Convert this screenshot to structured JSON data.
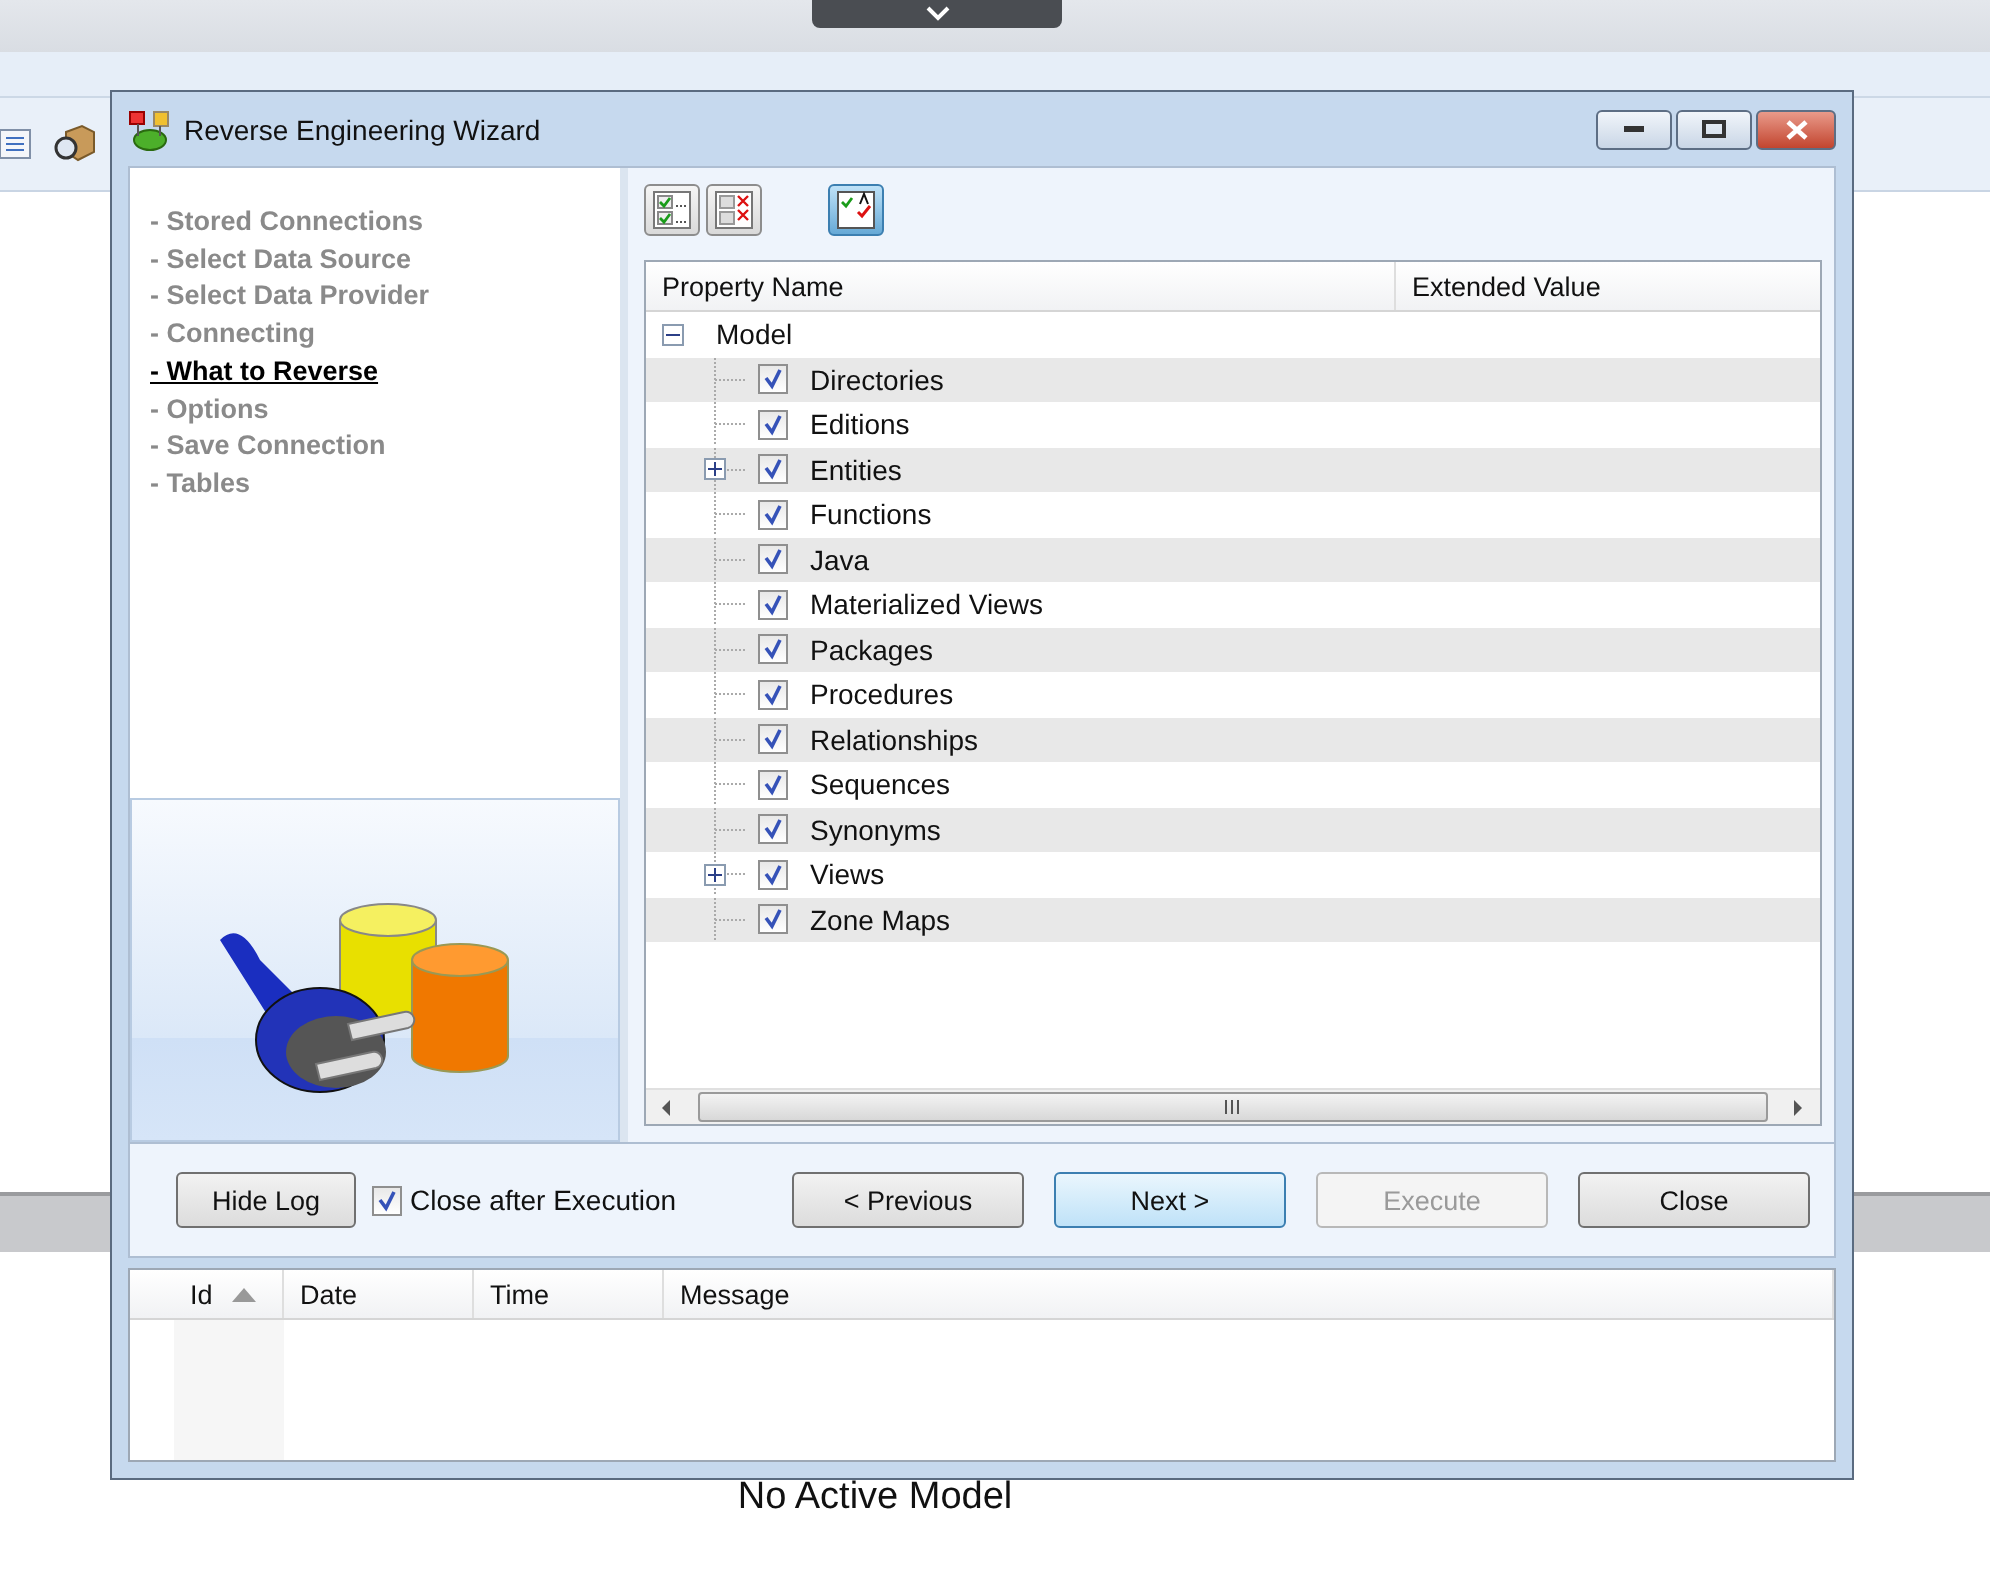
{
  "background": {
    "status_text": "No Active Model"
  },
  "window": {
    "title": "Reverse Engineering Wizard"
  },
  "steps": [
    {
      "label": "- Stored Connections",
      "selected": false
    },
    {
      "label": "- Select Data Source",
      "selected": false
    },
    {
      "label": "- Select Data Provider",
      "selected": false
    },
    {
      "label": "- Connecting",
      "selected": false
    },
    {
      "label": "- What to Reverse",
      "selected": true
    },
    {
      "label": "- Options",
      "selected": false
    },
    {
      "label": "- Save Connection",
      "selected": false
    },
    {
      "label": "- Tables",
      "selected": false
    }
  ],
  "toolbar": [
    {
      "kind": "check-all",
      "selected": false
    },
    {
      "kind": "uncheck-all",
      "selected": false
    },
    {
      "kind": "toggle-view",
      "selected": true
    }
  ],
  "tree": {
    "columns": [
      "Property Name",
      "Extended Value"
    ],
    "root": {
      "label": "Model",
      "expanded": true,
      "children": [
        {
          "label": "Directories",
          "checked": true,
          "expandable": false
        },
        {
          "label": "Editions",
          "checked": true,
          "expandable": false
        },
        {
          "label": "Entities",
          "checked": true,
          "expandable": true
        },
        {
          "label": "Functions",
          "checked": true,
          "expandable": false
        },
        {
          "label": "Java",
          "checked": true,
          "expandable": false
        },
        {
          "label": "Materialized Views",
          "checked": true,
          "expandable": false
        },
        {
          "label": "Packages",
          "checked": true,
          "expandable": false
        },
        {
          "label": "Procedures",
          "checked": true,
          "expandable": false
        },
        {
          "label": "Relationships",
          "checked": true,
          "expandable": false
        },
        {
          "label": "Sequences",
          "checked": true,
          "expandable": false
        },
        {
          "label": "Synonyms",
          "checked": true,
          "expandable": false
        },
        {
          "label": "Views",
          "checked": true,
          "expandable": true
        },
        {
          "label": "Zone Maps",
          "checked": true,
          "expandable": false
        }
      ]
    }
  },
  "hide_log": {
    "label": "Hide Log"
  },
  "close_after": {
    "label": "Close after Execution",
    "checked": true
  },
  "buttons": [
    {
      "label": "< Previous",
      "disabled": false,
      "default": false
    },
    {
      "label": "Next >",
      "disabled": false,
      "default": true
    },
    {
      "label": "Execute",
      "disabled": true,
      "default": false
    },
    {
      "label": "Close",
      "disabled": false,
      "default": false
    }
  ],
  "log": {
    "columns": [
      {
        "label": "Id",
        "sorted": true
      },
      {
        "label": "Date",
        "sorted": false
      },
      {
        "label": "Time",
        "sorted": false
      },
      {
        "label": "Message",
        "sorted": false
      }
    ]
  }
}
